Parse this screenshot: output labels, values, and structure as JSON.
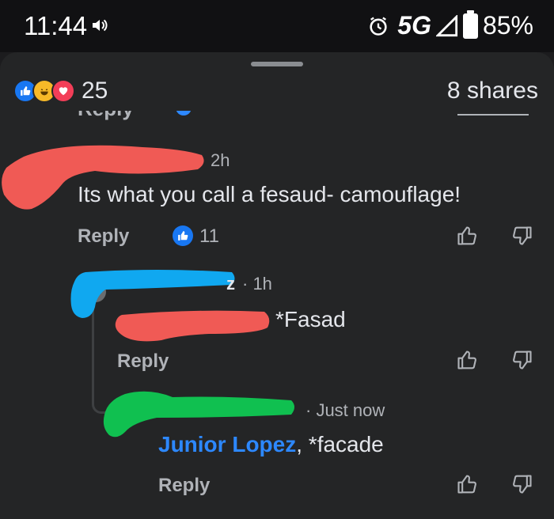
{
  "status_bar": {
    "time": "11:44",
    "network": "5G",
    "battery": "85%",
    "icons": [
      "volume-icon",
      "alarm-icon",
      "signal-icon",
      "battery-icon"
    ]
  },
  "summary": {
    "reaction_count": "25",
    "shares": "8 shares",
    "reaction_icons": [
      "like",
      "haha",
      "love"
    ]
  },
  "comments": [
    {
      "time": "2h",
      "text": "Its what you call a fesaud- camouflage!",
      "reply_label": "Reply",
      "like_count": "11"
    },
    {
      "author_partial": "z",
      "time": "· 1h",
      "text": "*Fasad",
      "reply_label": "Reply"
    },
    {
      "time": "· Just now",
      "mention": "Junior Lopez",
      "text": ", *facade",
      "reply_label": "Reply"
    }
  ],
  "colors": {
    "background": "#242526",
    "accent": "#1877f2",
    "mention": "#2d88ff",
    "redact_red": "#f05a55",
    "redact_blue": "#10a8f0",
    "redact_green": "#10c050"
  }
}
